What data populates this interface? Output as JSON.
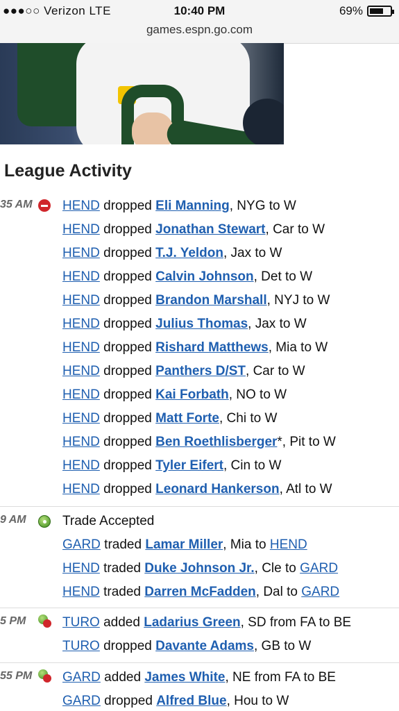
{
  "status_bar": {
    "carrier": "●●●○○ Verizon LTE",
    "time": "10:40 PM",
    "battery": "69%",
    "battery_level": 0.69
  },
  "browser": {
    "url": "games.espn.go.com"
  },
  "section_title": "League Activity",
  "groups": [
    {
      "time": "35 AM",
      "icon": "drop-icon",
      "lines": [
        {
          "team": "HEND",
          "action": " dropped ",
          "player": "Eli Manning",
          "rest": ", NYG to W"
        },
        {
          "team": "HEND",
          "action": " dropped ",
          "player": "Jonathan Stewart",
          "rest": ", Car to W"
        },
        {
          "team": "HEND",
          "action": " dropped ",
          "player": "T.J. Yeldon",
          "rest": ", Jax to W"
        },
        {
          "team": "HEND",
          "action": " dropped ",
          "player": "Calvin Johnson",
          "rest": ", Det to W"
        },
        {
          "team": "HEND",
          "action": " dropped ",
          "player": "Brandon Marshall",
          "rest": ", NYJ to W"
        },
        {
          "team": "HEND",
          "action": " dropped ",
          "player": "Julius Thomas",
          "rest": ", Jax to W"
        },
        {
          "team": "HEND",
          "action": " dropped ",
          "player": "Rishard Matthews",
          "rest": ", Mia to W"
        },
        {
          "team": "HEND",
          "action": " dropped ",
          "player": "Panthers D/ST",
          "rest": ", Car to W"
        },
        {
          "team": "HEND",
          "action": " dropped ",
          "player": "Kai Forbath",
          "rest": ", NO to W"
        },
        {
          "team": "HEND",
          "action": " dropped ",
          "player": "Matt Forte",
          "rest": ", Chi to W"
        },
        {
          "team": "HEND",
          "action": " dropped ",
          "player": "Ben Roethlisberger",
          "rest": "*, Pit to W"
        },
        {
          "team": "HEND",
          "action": " dropped ",
          "player": "Tyler Eifert",
          "rest": ", Cin to W"
        },
        {
          "team": "HEND",
          "action": " dropped ",
          "player": "Leonard Hankerson",
          "rest": ", Atl to W"
        }
      ]
    },
    {
      "time": "9 AM",
      "icon": "trade-icon",
      "header": "Trade Accepted",
      "lines": [
        {
          "team": "GARD",
          "action": " traded ",
          "player": "Lamar Miller",
          "rest": ", Mia to ",
          "team2": "HEND"
        },
        {
          "team": "HEND",
          "action": " traded ",
          "player": "Duke Johnson Jr.",
          "rest": ", Cle to ",
          "team2": "GARD"
        },
        {
          "team": "HEND",
          "action": " traded ",
          "player": "Darren McFadden",
          "rest": ", Dal to ",
          "team2": "GARD"
        }
      ]
    },
    {
      "time": "5 PM",
      "icon": "add-drop-icon",
      "lines": [
        {
          "team": "TURO",
          "action": " added ",
          "player": "Ladarius Green",
          "rest": ", SD from FA to BE"
        },
        {
          "team": "TURO",
          "action": " dropped ",
          "player": "Davante Adams",
          "rest": ", GB to W"
        }
      ]
    },
    {
      "time": "55 PM",
      "icon": "add-drop-icon",
      "lines": [
        {
          "team": "GARD",
          "action": " added ",
          "player": "James White",
          "rest": ", NE from FA to BE"
        },
        {
          "team": "GARD",
          "action": " dropped ",
          "player": "Alfred Blue",
          "rest": ", Hou to W"
        }
      ]
    }
  ]
}
